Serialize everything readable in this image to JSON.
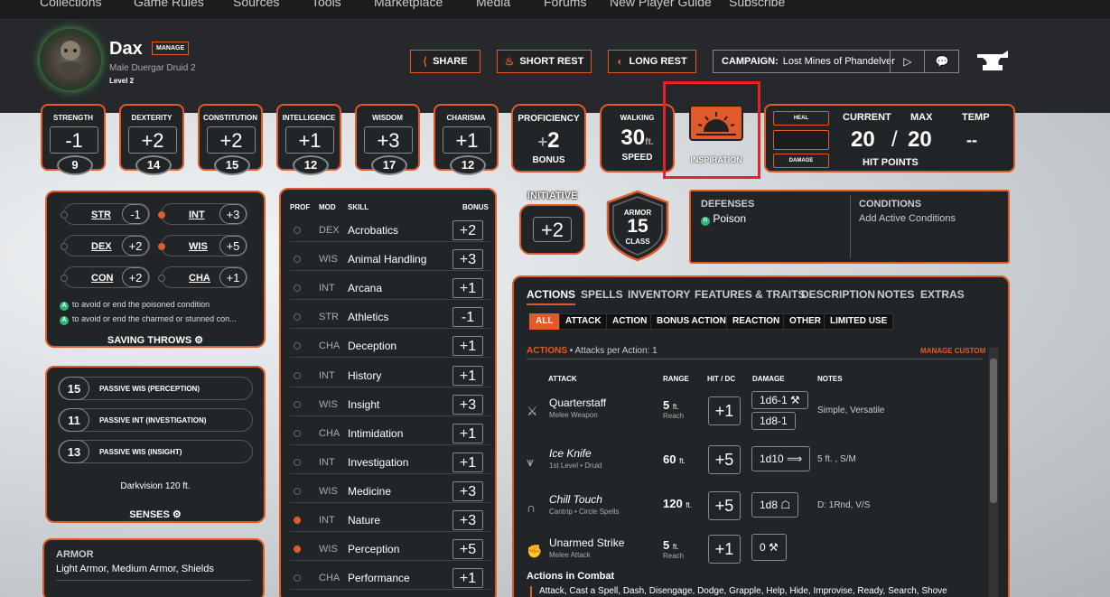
{
  "nav": [
    "Collections",
    "Game Rules",
    "Sources",
    "Tools",
    "Marketplace",
    "Media",
    "Forums",
    "New Player Guide",
    "Subscribe"
  ],
  "character": {
    "name": "Dax",
    "manage": "MANAGE",
    "subtitle": "Male  Duergar  Druid 2",
    "level": "Level 2"
  },
  "header": {
    "share": "SHARE",
    "short_rest": "SHORT REST",
    "long_rest": "LONG REST",
    "campaign_label": "CAMPAIGN:",
    "campaign_value": "Lost Mines of Phandelver"
  },
  "abilities": [
    {
      "name": "STRENGTH",
      "mod": "-1",
      "score": "9"
    },
    {
      "name": "DEXTERITY",
      "mod": "+2",
      "score": "14"
    },
    {
      "name": "CONSTITUTION",
      "mod": "+2",
      "score": "15"
    },
    {
      "name": "INTELLIGENCE",
      "mod": "+1",
      "score": "12"
    },
    {
      "name": "WISDOM",
      "mod": "+3",
      "score": "17"
    },
    {
      "name": "CHARISMA",
      "mod": "+1",
      "score": "12"
    }
  ],
  "proficiency": {
    "label": "PROFICIENCY",
    "sign": "+",
    "value": "2",
    "sub": "BONUS"
  },
  "speed": {
    "label": "WALKING",
    "value": "30",
    "unit": "ft.",
    "sub": "SPEED"
  },
  "inspiration": {
    "label": "INSPIRATION"
  },
  "hp": {
    "heal": "HEAL",
    "damage": "DAMAGE",
    "current_label": "CURRENT",
    "max_label": "MAX",
    "temp_label": "TEMP",
    "current": "20",
    "slash": "/",
    "max": "20",
    "temp": "--",
    "title": "HIT POINTS"
  },
  "saves": {
    "rows": [
      {
        "name": "STR",
        "val": "-1"
      },
      {
        "name": "INT",
        "val": "+3"
      },
      {
        "name": "DEX",
        "val": "+2"
      },
      {
        "name": "WIS",
        "val": "+5"
      },
      {
        "name": "CON",
        "val": "+2"
      },
      {
        "name": "CHA",
        "val": "+1"
      }
    ],
    "note1": "to avoid or end the poisoned condition",
    "note2": "to avoid or end the charmed or stunned con...",
    "badge": "A",
    "title": "SAVING THROWS"
  },
  "senses": {
    "passives": [
      {
        "val": "15",
        "label": "PASSIVE WIS (PERCEPTION)"
      },
      {
        "val": "11",
        "label": "PASSIVE INT (INVESTIGATION)"
      },
      {
        "val": "13",
        "label": "PASSIVE WIS (INSIGHT)"
      }
    ],
    "darkvision": "Darkvision 120 ft.",
    "title": "SENSES"
  },
  "proficiencies": {
    "title": "ARMOR",
    "value": "Light Armor, Medium Armor, Shields"
  },
  "skills": {
    "headers": {
      "prof": "PROF",
      "mod": "MOD",
      "skill": "SKILL",
      "bonus": "BONUS"
    },
    "rows": [
      {
        "mod": "DEX",
        "name": "Acrobatics",
        "bonus": "+2",
        "prof": false
      },
      {
        "mod": "WIS",
        "name": "Animal Handling",
        "bonus": "+3",
        "prof": false
      },
      {
        "mod": "INT",
        "name": "Arcana",
        "bonus": "+1",
        "prof": false
      },
      {
        "mod": "STR",
        "name": "Athletics",
        "bonus": "-1",
        "prof": false
      },
      {
        "mod": "CHA",
        "name": "Deception",
        "bonus": "+1",
        "prof": false
      },
      {
        "mod": "INT",
        "name": "History",
        "bonus": "+1",
        "prof": false
      },
      {
        "mod": "WIS",
        "name": "Insight",
        "bonus": "+3",
        "prof": false
      },
      {
        "mod": "CHA",
        "name": "Intimidation",
        "bonus": "+1",
        "prof": false
      },
      {
        "mod": "INT",
        "name": "Investigation",
        "bonus": "+1",
        "prof": false
      },
      {
        "mod": "WIS",
        "name": "Medicine",
        "bonus": "+3",
        "prof": false
      },
      {
        "mod": "INT",
        "name": "Nature",
        "bonus": "+3",
        "prof": true
      },
      {
        "mod": "WIS",
        "name": "Perception",
        "bonus": "+5",
        "prof": true
      },
      {
        "mod": "CHA",
        "name": "Performance",
        "bonus": "+1",
        "prof": false
      }
    ]
  },
  "initiative": {
    "label": "INITIATIVE",
    "value": "+2"
  },
  "armor": {
    "top": "ARMOR",
    "value": "15",
    "bottom": "CLASS"
  },
  "defenses": {
    "title": "DEFENSES",
    "badge": "R",
    "value": "Poison",
    "cond_title": "CONDITIONS",
    "cond_value": "Add Active Conditions"
  },
  "actions": {
    "tabs": [
      "ACTIONS",
      "SPELLS",
      "INVENTORY",
      "FEATURES & TRAITS",
      "DESCRIPTION",
      "NOTES",
      "EXTRAS"
    ],
    "filters": [
      "ALL",
      "ATTACK",
      "ACTION",
      "BONUS ACTION",
      "REACTION",
      "OTHER",
      "LIMITED USE"
    ],
    "section": "ACTIONS",
    "per_action": "• Attacks per Action: 1",
    "manage_custom": "MANAGE CUSTOM",
    "cols": {
      "attack": "ATTACK",
      "range": "RANGE",
      "hit": "HIT / DC",
      "damage": "DAMAGE",
      "notes": "NOTES"
    },
    "rows": [
      {
        "name": "Quarterstaff",
        "sub": "Melee Weapon",
        "range": "5",
        "range_unit": "ft.",
        "range_sub": "Reach",
        "hit": "+1",
        "dmg1": "1d6-1",
        "dmg2": "1d8-1",
        "notes": "Simple, Versatile"
      },
      {
        "name": "Ice Knife",
        "sub": "1st Level • Druid",
        "range": "60",
        "range_unit": "ft.",
        "range_sub": "",
        "hit": "+5",
        "dmg1": "1d10",
        "dmg2": "",
        "notes": "5 ft. , S/M"
      },
      {
        "name": "Chill Touch",
        "sub": "Cantrip • Circle Spells",
        "range": "120",
        "range_unit": "ft.",
        "range_sub": "",
        "hit": "+5",
        "dmg1": "1d8",
        "dmg2": "",
        "notes": "D: 1Rnd, V/S"
      },
      {
        "name": "Unarmed Strike",
        "sub": "Melee Attack",
        "range": "5",
        "range_unit": "ft.",
        "range_sub": "Reach",
        "hit": "+1",
        "dmg1": "0",
        "dmg2": "",
        "notes": ""
      }
    ],
    "combat_title": "Actions in Combat",
    "combat_list": "Attack, Cast a Spell, Dash, Disengage, Dodge, Grapple, Help, Hide, Improvise, Ready, Search, Shove"
  },
  "colors": {
    "accent": "#e05a2a",
    "panel": "#222527",
    "highlight": "#e8202a"
  }
}
